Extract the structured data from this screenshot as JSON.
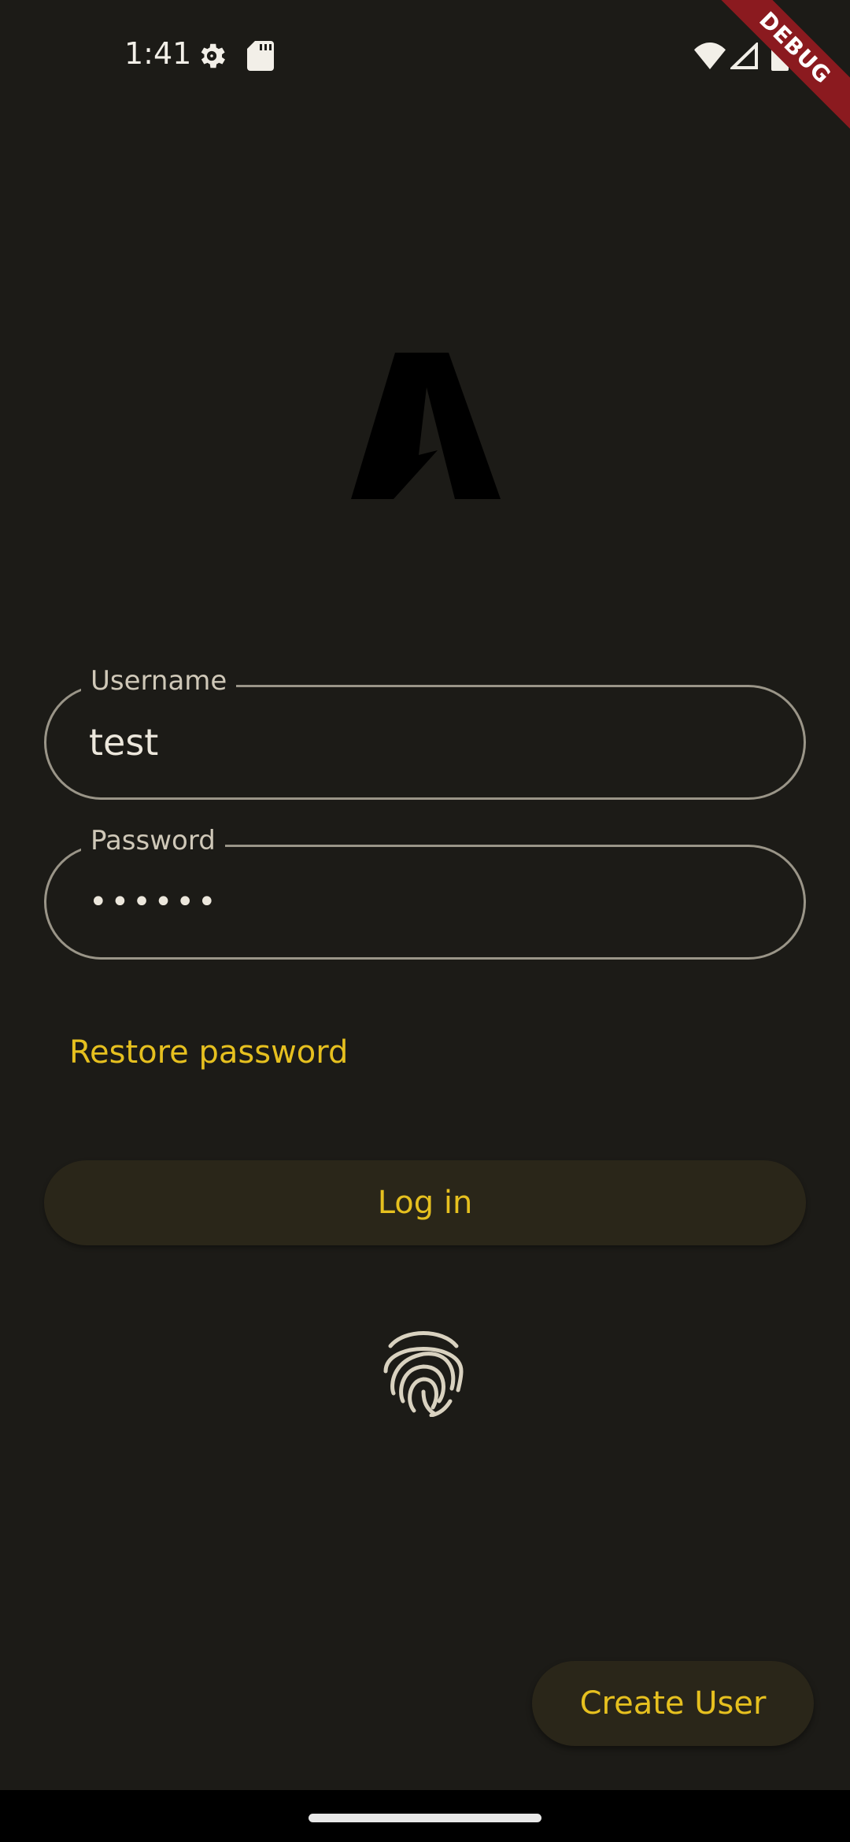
{
  "status_bar": {
    "time": "1:41",
    "icons": [
      "gear-icon",
      "sd-card-icon",
      "wifi-icon",
      "cellular-signal-icon",
      "battery-icon"
    ]
  },
  "debug_banner": {
    "label": "DEBUG",
    "color": "#8b1a1f"
  },
  "logo": {
    "icon": "app-logo-a"
  },
  "form": {
    "username": {
      "label": "Username",
      "value": "test"
    },
    "password": {
      "label": "Password",
      "value": "••••••"
    },
    "restore_password_label": "Restore password",
    "login_label": "Log in",
    "fingerprint_icon": "fingerprint-icon"
  },
  "create_user_label": "Create User",
  "colors": {
    "background": "#1c1b17",
    "accent": "#e6c01f",
    "outline": "#9a9588",
    "button_surface": "#2a2619"
  }
}
